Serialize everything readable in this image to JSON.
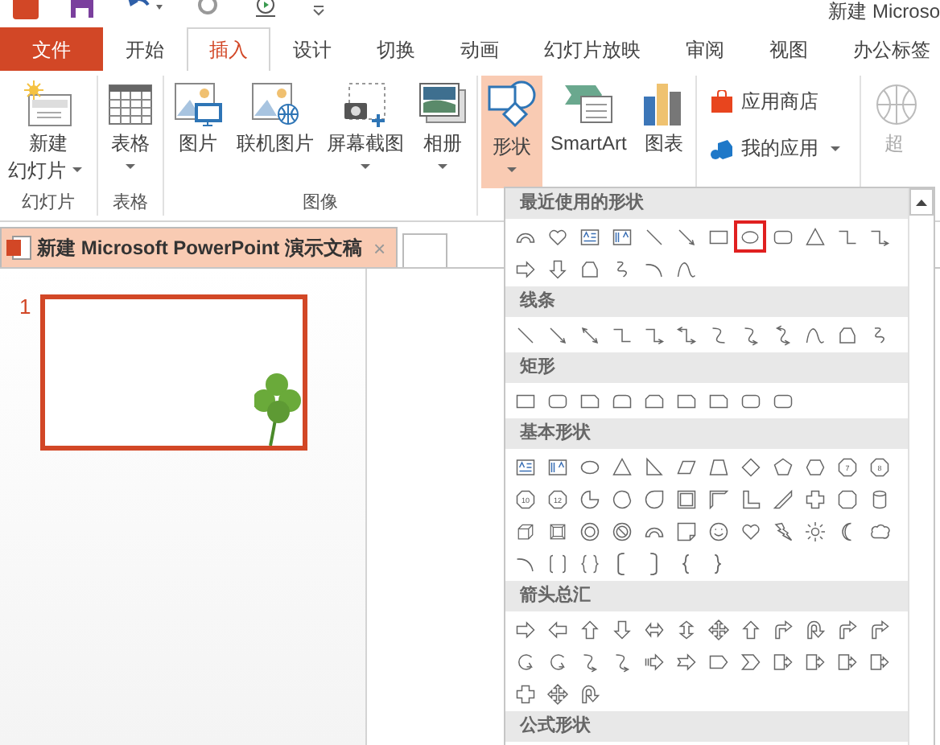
{
  "window": {
    "title": "新建 Microso"
  },
  "tabs": [
    {
      "label": "文件",
      "kind": "file",
      "selected": false
    },
    {
      "label": "开始",
      "kind": "tab",
      "selected": false
    },
    {
      "label": "插入",
      "kind": "tab",
      "selected": true
    },
    {
      "label": "设计",
      "kind": "tab",
      "selected": false
    },
    {
      "label": "切换",
      "kind": "tab",
      "selected": false
    },
    {
      "label": "动画",
      "kind": "tab",
      "selected": false
    },
    {
      "label": "幻灯片放映",
      "kind": "tab",
      "selected": false
    },
    {
      "label": "审阅",
      "kind": "tab",
      "selected": false
    },
    {
      "label": "视图",
      "kind": "tab",
      "selected": false
    },
    {
      "label": "办公标签",
      "kind": "tab",
      "selected": false
    }
  ],
  "ribbon": {
    "groups": [
      {
        "label": "幻灯片",
        "kind": "large",
        "buttons": [
          {
            "lines": [
              "新建",
              "幻灯片"
            ],
            "kind": "new-slide",
            "dropdown": true,
            "selected": false
          }
        ]
      },
      {
        "label": "表格",
        "kind": "large",
        "buttons": [
          {
            "label": "表格",
            "kind": "table",
            "dropdown": true,
            "selected": false
          }
        ]
      },
      {
        "label": "图像",
        "kind": "large",
        "buttons": [
          {
            "label": "图片",
            "kind": "picture",
            "dropdown": false,
            "selected": false
          },
          {
            "label": "联机图片",
            "kind": "online-picture",
            "dropdown": false,
            "selected": false
          },
          {
            "label": "屏幕截图",
            "kind": "screenshot",
            "dropdown": true,
            "selected": false
          },
          {
            "label": "相册",
            "kind": "album",
            "dropdown": true,
            "selected": false
          }
        ]
      },
      {
        "kind": "large",
        "buttons": [
          {
            "label": "形状",
            "kind": "shapes",
            "dropdown": true,
            "selected": true
          },
          {
            "label": "SmartArt",
            "kind": "smartart",
            "dropdown": false,
            "selected": false
          },
          {
            "label": "图表",
            "kind": "chart",
            "dropdown": false,
            "selected": false
          }
        ]
      },
      {
        "kind": "small",
        "buttons": [
          {
            "label": "应用商店",
            "kind": "store",
            "dropdown": false,
            "selected": false
          },
          {
            "label": "我的应用",
            "kind": "my-apps",
            "dropdown": true,
            "selected": false
          }
        ]
      },
      {
        "kind": "large",
        "buttons": [
          {
            "label": "超",
            "kind": "globe",
            "dropdown": false,
            "selected": false,
            "disabled": true
          }
        ]
      }
    ]
  },
  "document_tab": {
    "title": "新建 Microsoft PowerPoint 演示文稿",
    "close": "×"
  },
  "slides": [
    {
      "number": "1",
      "selected": true
    }
  ],
  "shapes_menu": {
    "sections": [
      {
        "title": "最近使用的形状",
        "shapes": [
          {
            "kind": "block-arc",
            "selected": false
          },
          {
            "kind": "heart",
            "selected": false
          },
          {
            "kind": "textbox",
            "selected": false
          },
          {
            "kind": "vtextbox",
            "selected": false
          },
          {
            "kind": "line",
            "selected": false
          },
          {
            "kind": "arrow-line",
            "selected": false
          },
          {
            "kind": "rect",
            "selected": false
          },
          {
            "kind": "oval",
            "selected": true
          },
          {
            "kind": "rounded-rect",
            "selected": false
          },
          {
            "kind": "triangle",
            "selected": false
          },
          {
            "kind": "elbow",
            "selected": false
          },
          {
            "kind": "elbow-arrow",
            "selected": false
          },
          {
            "kind": "right-arrow",
            "selected": false
          },
          {
            "kind": "down-arrow",
            "selected": false
          },
          {
            "kind": "freeform",
            "selected": false
          },
          {
            "kind": "scribble",
            "selected": false
          },
          {
            "kind": "arc",
            "selected": false
          },
          {
            "kind": "curve",
            "selected": false
          }
        ]
      },
      {
        "title": "线条",
        "shapes": [
          {
            "kind": "line",
            "selected": false
          },
          {
            "kind": "arrow-line",
            "selected": false
          },
          {
            "kind": "double-arrow",
            "selected": false
          },
          {
            "kind": "elbow",
            "selected": false
          },
          {
            "kind": "elbow-arrow",
            "selected": false
          },
          {
            "kind": "elbow-double-arrow",
            "selected": false
          },
          {
            "kind": "curved-connector",
            "selected": false
          },
          {
            "kind": "curved-arrow",
            "selected": false
          },
          {
            "kind": "curved-double-arrow",
            "selected": false
          },
          {
            "kind": "curve",
            "selected": false
          },
          {
            "kind": "freeform",
            "selected": false
          },
          {
            "kind": "scribble",
            "selected": false
          }
        ]
      },
      {
        "title": "矩形",
        "shapes": [
          {
            "kind": "rect",
            "selected": false
          },
          {
            "kind": "rounded-rect",
            "selected": false
          },
          {
            "kind": "snip-rect",
            "selected": false
          },
          {
            "kind": "round-top-rect",
            "selected": false
          },
          {
            "kind": "snip-two-rect",
            "selected": false
          },
          {
            "kind": "snip-rect",
            "selected": false
          },
          {
            "kind": "snip-rect",
            "selected": false
          },
          {
            "kind": "rounded-rect",
            "selected": false
          },
          {
            "kind": "rounded-rect",
            "selected": false
          }
        ]
      },
      {
        "title": "基本形状",
        "shapes": [
          {
            "kind": "textbox",
            "selected": false
          },
          {
            "kind": "vtextbox",
            "selected": false
          },
          {
            "kind": "oval",
            "selected": false
          },
          {
            "kind": "triangle",
            "selected": false
          },
          {
            "kind": "right-triangle",
            "selected": false
          },
          {
            "kind": "parallelogram",
            "selected": false
          },
          {
            "kind": "trapezoid",
            "selected": false
          },
          {
            "kind": "diamond",
            "selected": false
          },
          {
            "kind": "pentagon",
            "selected": false
          },
          {
            "kind": "hexagon",
            "selected": false
          },
          {
            "kind": "numbered",
            "label": "7",
            "selected": false
          },
          {
            "kind": "numbered",
            "label": "8",
            "selected": false
          },
          {
            "kind": "numbered",
            "label": "10",
            "selected": false
          },
          {
            "kind": "numbered",
            "label": "12",
            "selected": false
          },
          {
            "kind": "pie",
            "selected": false
          },
          {
            "kind": "chord",
            "selected": false
          },
          {
            "kind": "teardrop",
            "selected": false
          },
          {
            "kind": "frame",
            "selected": false
          },
          {
            "kind": "half-frame",
            "selected": false
          },
          {
            "kind": "l-shape",
            "selected": false
          },
          {
            "kind": "diagonal-stripe",
            "selected": false
          },
          {
            "kind": "cross",
            "selected": false
          },
          {
            "kind": "plaque",
            "selected": false
          },
          {
            "kind": "can",
            "selected": false
          },
          {
            "kind": "cube",
            "selected": false
          },
          {
            "kind": "bevel",
            "selected": false
          },
          {
            "kind": "donut",
            "selected": false
          },
          {
            "kind": "no-symbol",
            "selected": false
          },
          {
            "kind": "block-arc",
            "selected": false
          },
          {
            "kind": "folded-corner",
            "selected": false
          },
          {
            "kind": "smiley",
            "selected": false
          },
          {
            "kind": "heart",
            "selected": false
          },
          {
            "kind": "lightning",
            "selected": false
          },
          {
            "kind": "sun",
            "selected": false
          },
          {
            "kind": "moon",
            "selected": false
          },
          {
            "kind": "cloud",
            "selected": false
          },
          {
            "kind": "arc",
            "selected": false
          },
          {
            "kind": "bracket-pair",
            "selected": false
          },
          {
            "kind": "brace-pair",
            "selected": false
          },
          {
            "kind": "left-bracket",
            "selected": false
          },
          {
            "kind": "right-bracket",
            "selected": false
          },
          {
            "kind": "left-brace",
            "selected": false
          },
          {
            "kind": "right-brace",
            "selected": false
          }
        ]
      },
      {
        "title": "箭头总汇",
        "shapes": [
          {
            "kind": "right-arrow",
            "selected": false
          },
          {
            "kind": "left-arrow",
            "selected": false
          },
          {
            "kind": "up-arrow",
            "selected": false
          },
          {
            "kind": "down-arrow",
            "selected": false
          },
          {
            "kind": "left-right-arrow",
            "selected": false
          },
          {
            "kind": "up-down-arrow",
            "selected": false
          },
          {
            "kind": "quad-arrow",
            "selected": false
          },
          {
            "kind": "up-arrow",
            "selected": false
          },
          {
            "kind": "bent-arrow",
            "selected": false
          },
          {
            "kind": "u-turn-arrow",
            "selected": false
          },
          {
            "kind": "bent-arrow",
            "selected": false
          },
          {
            "kind": "bent-arrow",
            "selected": false
          },
          {
            "kind": "circular-arrow",
            "selected": false
          },
          {
            "kind": "circular-arrow",
            "selected": false
          },
          {
            "kind": "curved-arrow",
            "selected": false
          },
          {
            "kind": "curved-arrow",
            "selected": false
          },
          {
            "kind": "striped-arrow",
            "selected": false
          },
          {
            "kind": "notched-arrow",
            "selected": false
          },
          {
            "kind": "pentagon-arrow",
            "selected": false
          },
          {
            "kind": "chevron",
            "selected": false
          },
          {
            "kind": "callout",
            "selected": false
          },
          {
            "kind": "callout",
            "selected": false
          },
          {
            "kind": "callout",
            "selected": false
          },
          {
            "kind": "callout",
            "selected": false
          },
          {
            "kind": "cross",
            "selected": false
          },
          {
            "kind": "quad-arrow",
            "selected": false
          },
          {
            "kind": "u-turn-arrow",
            "selected": false
          }
        ]
      },
      {
        "title": "公式形状"
      }
    ]
  }
}
